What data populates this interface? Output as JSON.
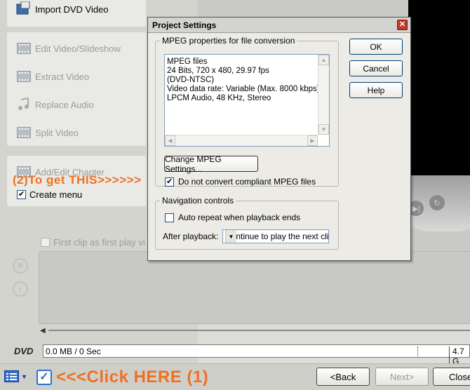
{
  "tasks": {
    "import": "Import DVD Video",
    "edit": "Edit Video/Slideshow",
    "extract": "Extract Video",
    "replace_audio": "Replace Audio",
    "split": "Split Video",
    "add_chapter": "Add/Edit Chapter",
    "create_menu": "Create menu",
    "first_clip": "First clip as first play vi"
  },
  "capacity": {
    "label": "DVD",
    "used": "0.0 MB / 0 Sec",
    "max": "4.7 G"
  },
  "bottom": {
    "back": "<Back",
    "next": "Next>",
    "close": "Close"
  },
  "annotations": {
    "step2": "(2)To get THIS>>>>>>",
    "step1": "<<<Click HERE (1)"
  },
  "dialog": {
    "title": "Project Settings",
    "mpeg_group": "MPEG properties for file conversion",
    "info_lines": [
      "MPEG files",
      "24 Bits, 720 x 480, 29.97 fps",
      "(DVD-NTSC)",
      "Video data rate: Variable (Max.  8000 kbps)",
      "LPCM Audio, 48 KHz, Stereo"
    ],
    "change_button": "Change MPEG Settings...",
    "no_convert": "Do not convert compliant MPEG files",
    "ok": "OK",
    "cancel": "Cancel",
    "help": "Help",
    "nav_group": "Navigation controls",
    "auto_repeat": "Auto repeat when playback ends",
    "after_playback_label": "After playback:",
    "after_playback_value": "Continue to play the next cli"
  },
  "colors": {
    "annotation": "#f07020",
    "check": "#21a121"
  }
}
